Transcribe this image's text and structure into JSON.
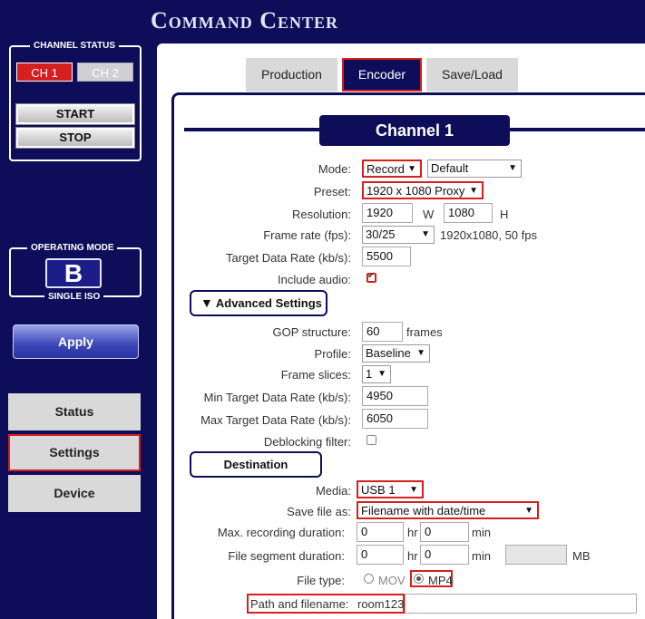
{
  "app_title": "Command Center",
  "sidebar": {
    "channel_status": {
      "title": "CHANNEL STATUS",
      "ch1": "CH 1",
      "ch2": "CH 2",
      "start": "START",
      "stop": "STOP"
    },
    "operating_mode": {
      "title": "OPERATING MODE",
      "letter": "B",
      "label": "SINGLE ISO"
    },
    "apply": "Apply",
    "nav": {
      "status": "Status",
      "settings": "Settings",
      "device": "Device"
    }
  },
  "tabs": {
    "production": "Production",
    "encoder": "Encoder",
    "save_load": "Save/Load"
  },
  "channel_title": "Channel 1",
  "form": {
    "mode": {
      "label": "Mode:",
      "value": "Record",
      "profile": "Default"
    },
    "preset": {
      "label": "Preset:",
      "value": "1920 x 1080 Proxy"
    },
    "resolution": {
      "label": "Resolution:",
      "w": "1920",
      "w_label": "W",
      "h": "1080",
      "h_label": "H"
    },
    "frame_rate": {
      "label": "Frame rate (fps):",
      "value": "30/25",
      "note": "1920x1080, 50 fps"
    },
    "target_rate": {
      "label": "Target Data Rate (kb/s):",
      "value": "5500"
    },
    "include_audio": {
      "label": "Include audio:",
      "checked": true
    },
    "advanced_header": "Advanced Settings",
    "gop": {
      "label": "GOP structure:",
      "value": "60",
      "unit": "frames"
    },
    "profile": {
      "label": "Profile:",
      "value": "Baseline"
    },
    "slices": {
      "label": "Frame slices:",
      "value": "1"
    },
    "min_rate": {
      "label": "Min Target Data Rate (kb/s):",
      "value": "4950"
    },
    "max_rate": {
      "label": "Max Target Data Rate (kb/s):",
      "value": "6050"
    },
    "deblocking": {
      "label": "Deblocking filter:",
      "checked": false
    },
    "destination_header": "Destination",
    "media": {
      "label": "Media:",
      "value": "USB 1"
    },
    "save_as": {
      "label": "Save file as:",
      "value": "Filename with date/time"
    },
    "max_duration": {
      "label": "Max. recording duration:",
      "hr": "0",
      "hr_label": "hr",
      "min": "0",
      "min_label": "min"
    },
    "segment_duration": {
      "label": "File segment duration:",
      "hr": "0",
      "hr_label": "hr",
      "min": "0",
      "min_label": "min",
      "mb": "",
      "mb_label": "MB"
    },
    "file_type": {
      "label": "File type:",
      "mov": "MOV",
      "mp4": "MP4",
      "selected": "MP4"
    },
    "path": {
      "label": "Path and filename:",
      "value": "room123"
    }
  }
}
